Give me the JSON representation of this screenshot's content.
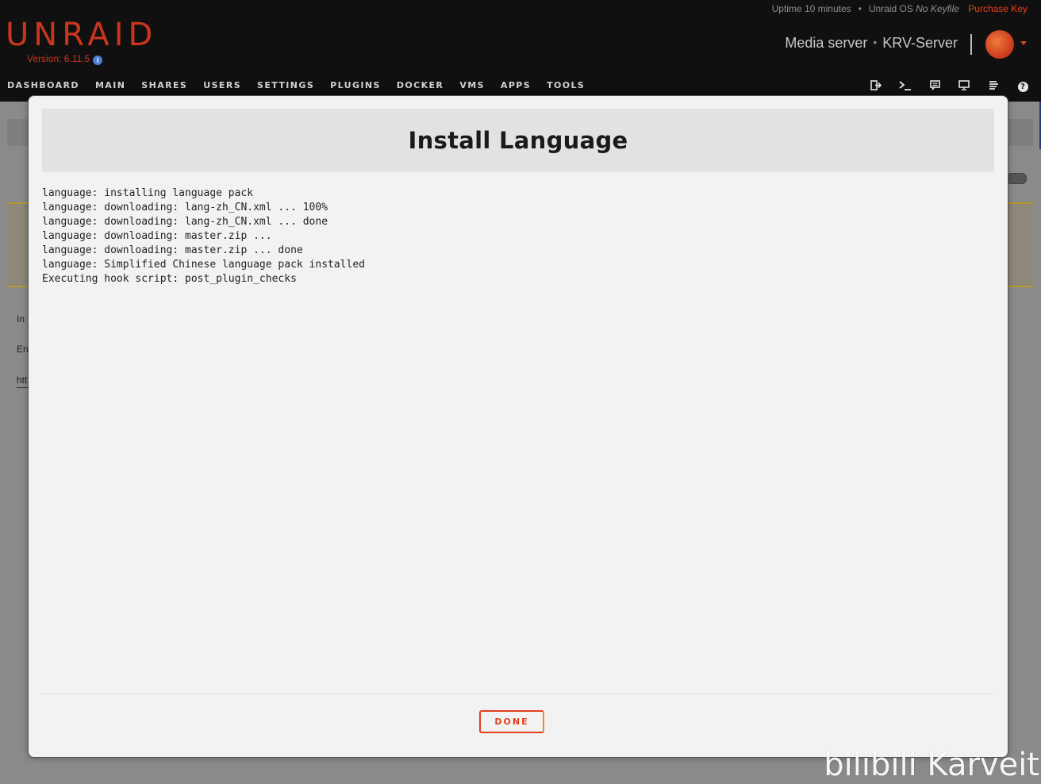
{
  "header": {
    "uptime": "Uptime 10 minutes",
    "os_label": "Unraid OS",
    "keyfile_status": "No Keyfile",
    "purchase_key": "Purchase Key",
    "logo": "UNRAID",
    "version": "Version: 6.11.5",
    "server_description": "Media server",
    "server_name": "KRV-Server",
    "accent_color": "#e2401b"
  },
  "nav": {
    "items": [
      "DASHBOARD",
      "MAIN",
      "SHARES",
      "USERS",
      "SETTINGS",
      "PLUGINS",
      "DOCKER",
      "VMS",
      "APPS",
      "TOOLS"
    ],
    "icons": [
      "logout-icon",
      "terminal-icon",
      "feedback-icon",
      "display-icon",
      "log-icon",
      "help-icon"
    ]
  },
  "background": {
    "text_1": "In",
    "text_2": "En",
    "text_3": "htt"
  },
  "modal": {
    "title": "Install Language",
    "log": [
      "language: installing language pack",
      "language: downloading: lang-zh_CN.xml ... 100%",
      "language: downloading: lang-zh_CN.xml ... done",
      "language: downloading: master.zip ...",
      "language: downloading: master.zip ... done",
      "language: Simplified Chinese language pack installed",
      "Executing hook script: post_plugin_checks"
    ],
    "done_label": "DONE"
  },
  "watermark": "bilibili Karveit"
}
